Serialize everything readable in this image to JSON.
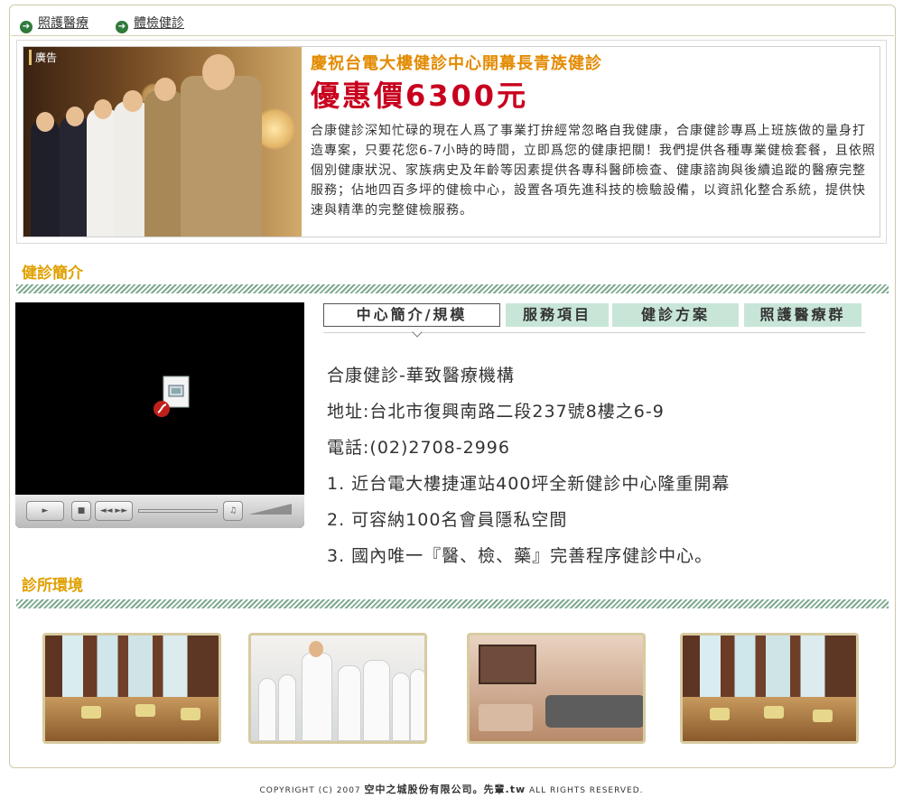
{
  "nav": {
    "items": [
      {
        "label": "照護醫療"
      },
      {
        "label": "體檢健診"
      }
    ]
  },
  "ad": {
    "tag": "廣告",
    "title": "慶祝台電大樓健診中心開幕長青族健診",
    "price": "優惠價6300元",
    "body": "合康健診深知忙碌的現在人爲了事業打拚經常忽略自我健康，合康健診專爲上班族做的量身打造專案，只要花您6-7小時的時間，立即爲您的健康把關！我們提供各種專業健檢套餐，且依照個別健康狀況、家族病史及年齡等因素提供各專科醫師檢查、健康諮詢與後續追蹤的醫療完整服務；佔地四百多坪的健檢中心，設置各項先進科技的檢驗設備，以資訊化整合系統，提供快速與精準的完整健檢服務。"
  },
  "sections": {
    "intro": "健診簡介",
    "environment": "診所環境"
  },
  "tabs": [
    {
      "label": "中心簡介/規模",
      "active": true
    },
    {
      "label": "服務項目",
      "active": false
    },
    {
      "label": "健診方案",
      "active": false
    },
    {
      "label": "照護醫療群",
      "active": false
    }
  ],
  "info": {
    "name": "合康健診-華致醫療機構",
    "address": "地址:台北市復興南路二段237號8樓之6-9",
    "phone": "電話:(02)2708-2996",
    "points": [
      "1. 近台電大樓捷運站400坪全新健診中心隆重開幕",
      "2. 可容納100名會員隱私空間",
      "3. 國內唯一『醫、檢、藥』完善程序健診中心。"
    ]
  },
  "footer": {
    "left": "COPYRIGHT (C) 2007",
    "company": "空中之城股份有限公司。先輩.tw",
    "right": "ALL RIGHTS RESERVED."
  },
  "colors": {
    "accent_orange": "#e38a00",
    "price_red": "#c8001e",
    "tab_green": "#c8e6d8",
    "stripe_green": "#7ea98f",
    "nav_arrow": "#2f7a3b"
  }
}
